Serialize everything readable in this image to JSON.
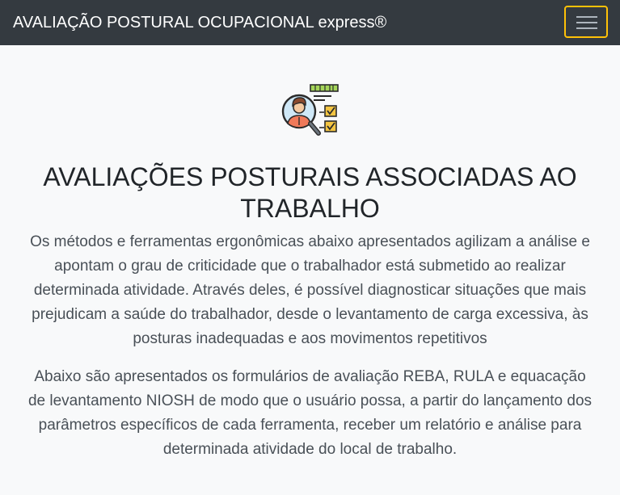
{
  "navbar": {
    "brand": "AVALIAÇÃO POSTURAL OCUPACIONAL express®",
    "toggle_icon": "hamburger-menu-icon",
    "toggle_border_color": "#ffc107",
    "background_color": "#343a40"
  },
  "hero": {
    "icon": "ergonomic-assessment-icon",
    "title": "AVALIAÇÕES POSTURAIS ASSOCIADAS AO TRABALHO",
    "paragraphs": [
      "Os métodos e ferramentas ergonômicas abaixo apresentados agilizam a análise e apontam o grau de criticidade que o trabalhador está submetido ao realizar determinada atividade. Através deles, é possível diagnosticar situações que mais prejudicam a saúde do trabalhador, desde o levantamento de carga excessiva, às posturas inadequadas e aos movimentos repetitivos",
      "Abaixo são apresentados os formulários de avaliação REBA, RULA e equacação de levantamento NIOSH de modo que o usuário possa, a partir do lançamento dos parâmetros específicos de cada ferramenta, receber um relatório e análise para determinada atividade do local de trabalho."
    ]
  }
}
